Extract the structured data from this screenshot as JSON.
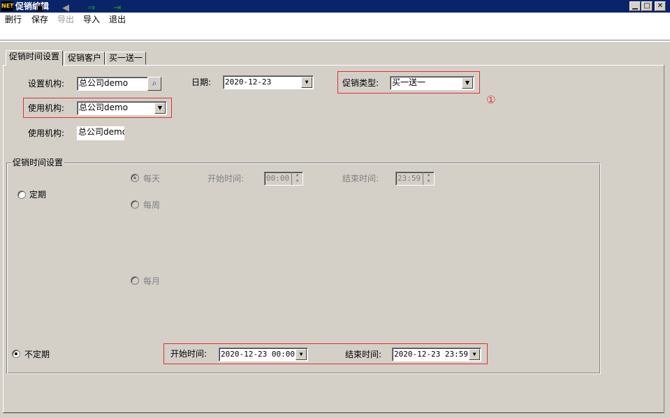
{
  "window": {
    "title": "促销编辑",
    "app_badge": "NET",
    "controls": {
      "minimize": "▁",
      "maximize": "□",
      "close": "✕"
    }
  },
  "toolbar": {
    "items": [
      {
        "label": "删行",
        "icon": "delete-row-icon",
        "glyph": "⇨",
        "enabled": true
      },
      {
        "label": "保存",
        "icon": "save-icon",
        "glyph": "▣",
        "enabled": true
      },
      {
        "label": "导出",
        "icon": "export-icon",
        "glyph": "◀",
        "enabled": false
      },
      {
        "label": "导入",
        "icon": "import-icon",
        "glyph": "⇒",
        "enabled": true
      },
      {
        "label": "退出",
        "icon": "exit-icon",
        "glyph": "⇥",
        "enabled": true
      }
    ]
  },
  "tabs": [
    {
      "label": "促销时间设置",
      "active": true
    },
    {
      "label": "促销客户",
      "active": false
    },
    {
      "label": "买一送一",
      "active": false
    }
  ],
  "form": {
    "set_org_label": "设置机构:",
    "set_org_value": "总公司demo",
    "date_label": "日期:",
    "date_value": "2020-12-23",
    "promo_type_label": "促销类型:",
    "promo_type_value": "买一送一",
    "use_org_label": "使用机构:",
    "use_org_value": "总公司demo",
    "use_org2_label": "使用机构:",
    "use_org2_value": "总公司demo",
    "marker": "①"
  },
  "time_group": {
    "title": "促销时间设置",
    "fixed_label": "定期",
    "daily_label": "每天",
    "weekly_label": "每周",
    "monthly_label": "每月",
    "start_label": "开始时间:",
    "start_value": "00:00",
    "end_label": "结束时间:",
    "end_value": "23:59",
    "unfixed_label": "不定期",
    "range_start_label": "开始时间:",
    "range_start_value": "2020-12-23 00:00",
    "range_end_label": "结束时间:",
    "range_end_value": "2020-12-23 23:59"
  },
  "colors": {
    "titlebar": "#0a246a",
    "face": "#d4d0c8",
    "highlight_box": "#e03030"
  }
}
